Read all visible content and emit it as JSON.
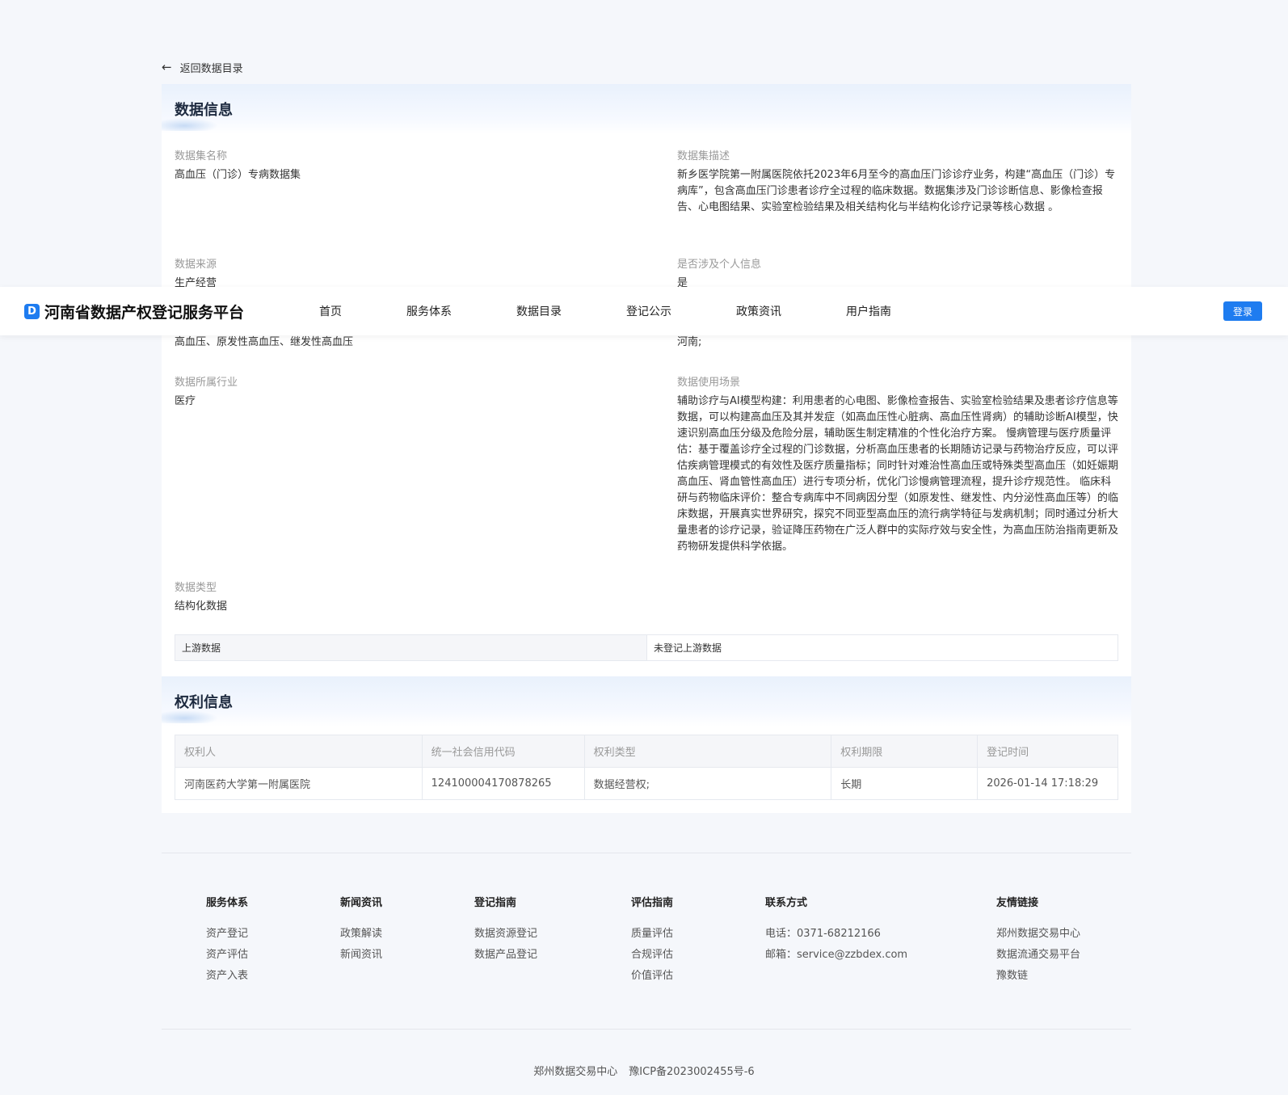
{
  "back_link": "返回数据目录",
  "data_section": {
    "title": "数据信息",
    "fields": {
      "name": {
        "label": "数据集名称",
        "value": "高血压（门诊）专病数据集"
      },
      "description": {
        "label": "数据集描述",
        "value": "新乡医学院第一附属医院依托2023年6月至今的高血压门诊诊疗业务，构建“高血压（门诊）专病库”，包含高血压门诊患者诊疗全过程的临床数据。数据集涉及门诊诊断信息、影像检查报告、心电图结果、实验室检验结果及相关结构化与半结构化诊疗记录等核心数据 。"
      },
      "source": {
        "label": "数据来源",
        "value": "生产经营"
      },
      "personal_info": {
        "label": "是否涉及个人信息",
        "value": "是"
      },
      "keywords_value": "高血压、原发性高血压、继发性高血压",
      "region_value": "河南;",
      "industry": {
        "label": "数据所属行业",
        "value": "医疗"
      },
      "scenario": {
        "label": "数据使用场景",
        "value": "辅助诊疗与AI模型构建：利用患者的心电图、影像检查报告、实验室检验结果及患者诊疗信息等数据，可以构建高血压及其并发症（如高血压性心脏病、高血压性肾病）的辅助诊断AI模型，快速识别高血压分级及危险分层，辅助医生制定精准的个性化治疗方案。 慢病管理与医疗质量评估：基于覆盖诊疗全过程的门诊数据，分析高血压患者的长期随访记录与药物治疗反应，可以评估疾病管理模式的有效性及医疗质量指标；同时针对难治性高血压或特殊类型高血压（如妊娠期高血压、肾血管性高血压）进行专项分析，优化门诊慢病管理流程，提升诊疗规范性。 临床科研与药物临床评价：整合专病库中不同病因分型（如原发性、继发性、内分泌性高血压等）的临床数据，开展真实世界研究，探究不同亚型高血压的流行病学特征与发病机制；同时通过分析大量患者的诊疗记录，验证降压药物在广泛人群中的实际疗效与安全性，为高血压防治指南更新及药物研发提供科学依据。"
      },
      "type": {
        "label": "数据类型",
        "value": "结构化数据"
      }
    },
    "upstream": {
      "label": "上游数据",
      "value": "未登记上游数据"
    }
  },
  "rights_section": {
    "title": "权利信息",
    "headers": [
      "权利人",
      "统一社会信用代码",
      "权利类型",
      "权利期限",
      "登记时间"
    ],
    "rows": [
      [
        "河南医药大学第一附属医院",
        "124100004170878265",
        "数据经营权;",
        "长期",
        "2026-01-14 17:18:29"
      ]
    ]
  },
  "navbar": {
    "logo_glyph": "D",
    "brand": "河南省数据产权登记服务平台",
    "items": [
      "首页",
      "服务体系",
      "数据目录",
      "登记公示",
      "政策资讯",
      "用户指南"
    ],
    "login": "登录"
  },
  "footer": {
    "columns": [
      {
        "title": "服务体系",
        "items": [
          "资产登记",
          "资产评估",
          "资产入表"
        ]
      },
      {
        "title": "新闻资讯",
        "items": [
          "政策解读",
          "新闻资讯"
        ]
      },
      {
        "title": "登记指南",
        "items": [
          "数据资源登记",
          "数据产品登记"
        ]
      },
      {
        "title": "评估指南",
        "items": [
          "质量评估",
          "合规评估",
          "价值评估"
        ]
      },
      {
        "title": "联系方式",
        "items": [
          "电话：0371-68212166",
          "邮箱：service@zzbdex.com"
        ]
      },
      {
        "title": "友情链接",
        "items": [
          "郑州数据交易中心",
          "数据流通交易平台",
          "豫数链"
        ]
      }
    ],
    "copyright": [
      "郑州数据交易中心",
      "豫ICP备2023002455号-6"
    ]
  },
  "colors": {
    "primary": "#1e7cf0",
    "page_bg": "#f5f7fb"
  }
}
